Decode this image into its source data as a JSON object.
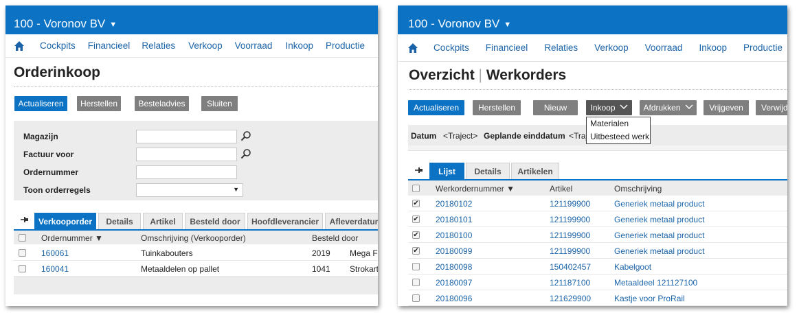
{
  "left": {
    "company": "100 - Voronov BV",
    "nav": [
      "Cockpits",
      "Financieel",
      "Relaties",
      "Verkoop",
      "Voorraad",
      "Inkoop",
      "Productie"
    ],
    "title": "Orderinkoop",
    "buttons": [
      "Actualiseren",
      "Herstellen",
      "Besteladvies",
      "Sluiten"
    ],
    "filters": {
      "magazijn": "Magazijn",
      "factuur": "Factuur voor",
      "ordernummer": "Ordernummer",
      "toon": "Toon orderregels"
    },
    "tabs": [
      "Verkooporder",
      "Details",
      "Artikel",
      "Besteld door",
      "Hoofdleverancier",
      "Afleverdatum"
    ],
    "columns": [
      "Ordernummer ▼",
      "Omschrijving (Verkooporder)",
      "Besteld door"
    ],
    "rows": [
      {
        "nr": "160061",
        "desc": "Tuinkabouters",
        "code": "2019",
        "name": "Mega Fo"
      },
      {
        "nr": "160041",
        "desc": "Metaaldelen op pallet",
        "code": "1041",
        "name": "Strokarto"
      }
    ]
  },
  "right": {
    "company": "100 - Voronov BV",
    "nav": [
      "Cockpits",
      "Financieel",
      "Relaties",
      "Verkoop",
      "Voorraad",
      "Inkoop",
      "Productie"
    ],
    "title_a": "Overzicht",
    "title_sep": "|",
    "title_b": "Werkorders",
    "buttons": [
      "Actualiseren",
      "Herstellen",
      "Nieuw",
      "Inkoop",
      "Afdrukken",
      "Vrijgeven",
      "Verwijd"
    ],
    "dropdown": [
      "Materialen",
      "Uitbesteed werk"
    ],
    "filterbar": {
      "datum": "Datum",
      "traject": "<Traject>",
      "gepland": "Geplande einddatum",
      "traject2": "<Traj"
    },
    "tabs": [
      "Lijst",
      "Details",
      "Artikelen"
    ],
    "columns": [
      "Werkordernummer ▼",
      "Artikel",
      "Omschrijving"
    ],
    "rows": [
      {
        "checked": true,
        "nr": "20180102",
        "art": "121199900",
        "desc": "Generiek metaal product"
      },
      {
        "checked": true,
        "nr": "20180101",
        "art": "121199900",
        "desc": "Generiek metaal product"
      },
      {
        "checked": true,
        "nr": "20180100",
        "art": "121199900",
        "desc": "Generiek metaal product"
      },
      {
        "checked": true,
        "nr": "20180099",
        "art": "121199900",
        "desc": "Generiek metaal product"
      },
      {
        "checked": false,
        "nr": "20180098",
        "art": "150402457",
        "desc": "Kabelgoot"
      },
      {
        "checked": false,
        "nr": "20180097",
        "art": "121187100",
        "desc": "Metaaldeel 121127100"
      },
      {
        "checked": false,
        "nr": "20180096",
        "art": "121629900",
        "desc": "Kastje voor ProRail"
      }
    ],
    "check_mark": "✔"
  },
  "icons": {
    "home": "home-icon",
    "search": "search-icon",
    "pin": "pin-icon",
    "caret": "chevron-down-icon"
  },
  "colors": {
    "brand": "#0b72c4",
    "link": "#1a63a8",
    "gray_button": "#7f7f7f",
    "panel_bg": "#ececec"
  }
}
